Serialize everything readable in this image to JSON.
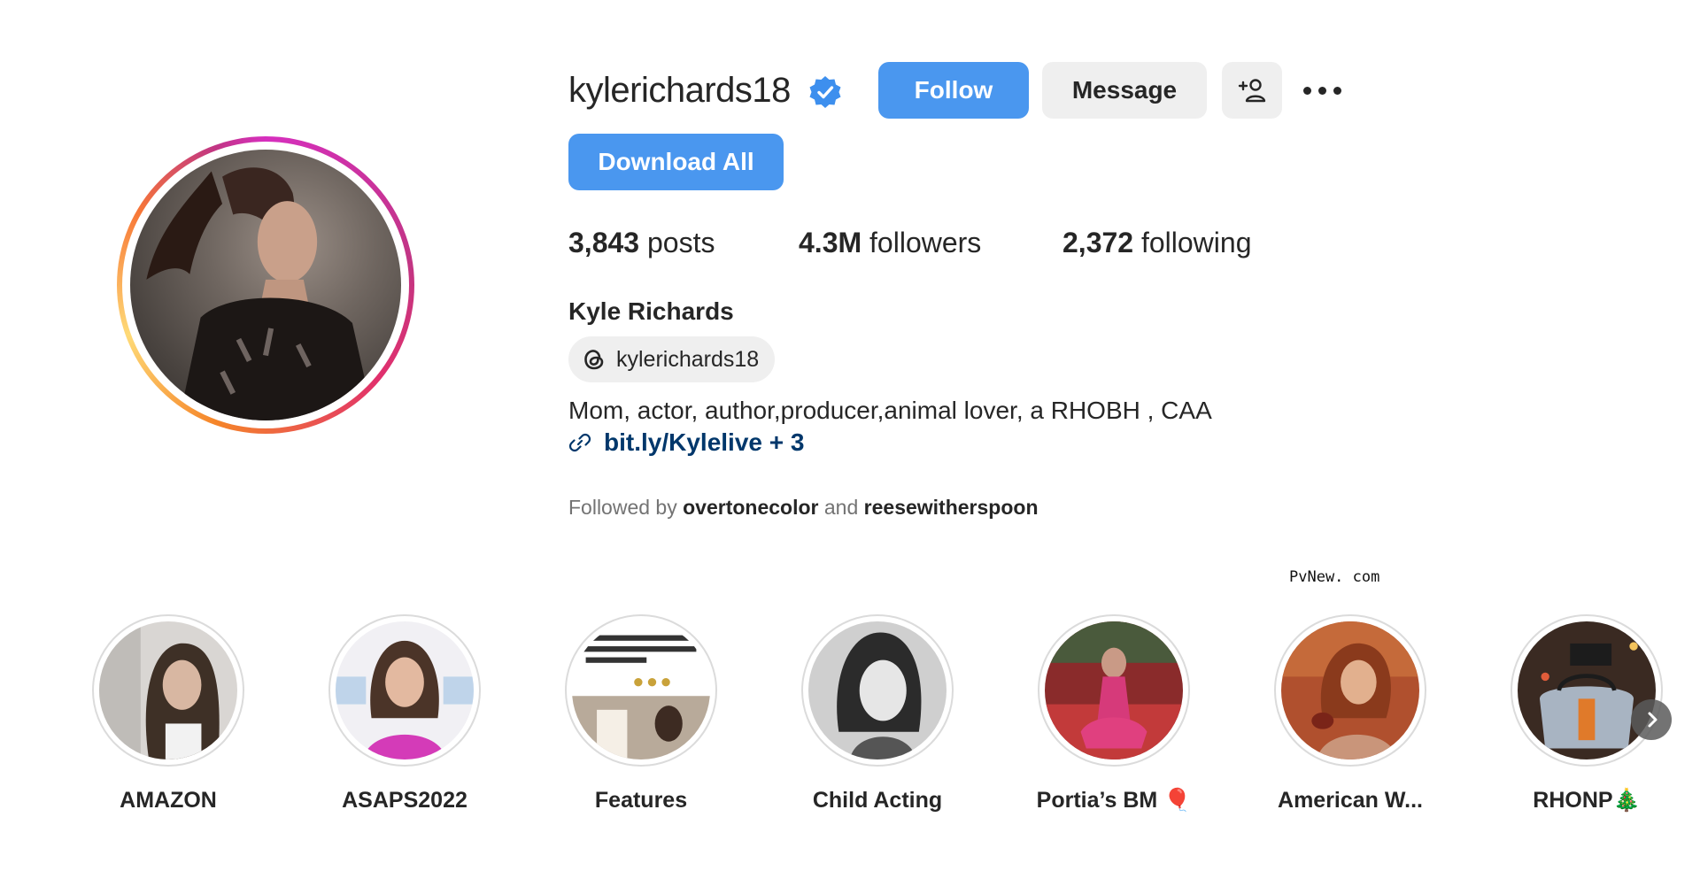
{
  "profile": {
    "username": "kylerichards18",
    "verified": true,
    "follow_label": "Follow",
    "message_label": "Message",
    "download_label": "Download All",
    "full_name": "Kyle Richards",
    "threads_handle": "kylerichards18",
    "bio": "Mom, actor, author,producer,animal lover, a RHOBH , CAA",
    "link": "bit.ly/Kylelive + 3",
    "followed_by_prefix": "Followed by",
    "followed_by_1": "overtonecolor",
    "followed_by_and": "and",
    "followed_by_2": "reesewitherspoon"
  },
  "stats": {
    "posts_value": "3,843",
    "posts_label": "posts",
    "followers_value": "4.3M",
    "followers_label": "followers",
    "following_value": "2,372",
    "following_label": "following"
  },
  "watermark": "PvNew. com",
  "highlights": [
    {
      "label": "AMAZON"
    },
    {
      "label": "ASAPS2022"
    },
    {
      "label": "Features"
    },
    {
      "label": "Child Acting"
    },
    {
      "label": "Portia’s BM 🎈"
    },
    {
      "label": "American W..."
    },
    {
      "label": "RHONP🎄"
    }
  ],
  "icons": {
    "verified": "verified-badge-icon",
    "add_user": "add-user-icon",
    "more": "more-options-icon",
    "threads": "threads-icon",
    "link": "link-icon",
    "next": "chevron-right-icon"
  },
  "colors": {
    "primary_button": "#4a97ef",
    "secondary_button": "#efefef",
    "link": "#00376b",
    "muted_text": "#737373",
    "verified": "#3d8fee"
  }
}
